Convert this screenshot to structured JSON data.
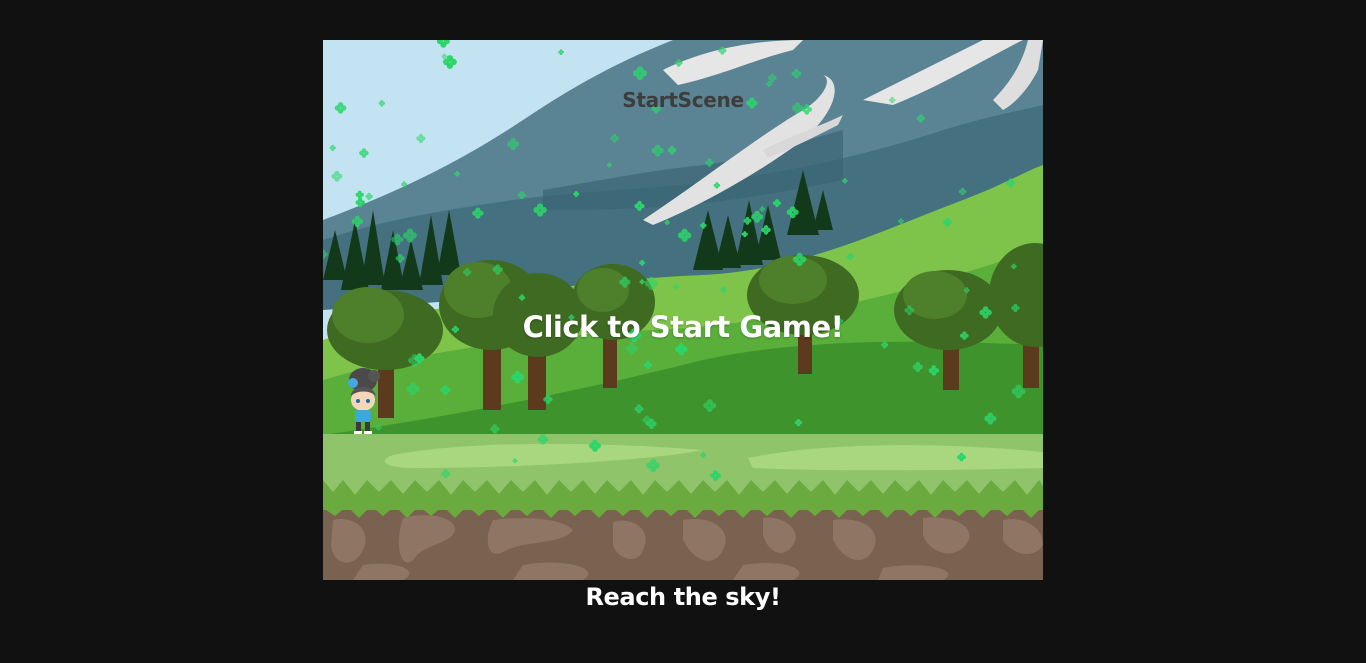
{
  "game": {
    "scene_label": "StartScene",
    "start_prompt": "Click to Start Game!",
    "caption": "Reach the sky!"
  },
  "colors": {
    "page_background": "#111111",
    "sky": "#c4e3f2",
    "mountain_far": "#5a8494",
    "mountain_near": "#44707f",
    "snow": "#e6e6e6",
    "hill_light": "#7fc44a",
    "hill_mid": "#5aae3a",
    "hill_dark": "#3f932c",
    "pine": "#123a1a",
    "tree_foliage": "#3f6a22",
    "tree_trunk": "#5b3a1e",
    "ground_grass": "#8fc46a",
    "ground_path": "#a9d77f",
    "dirt": "#7a6250",
    "dirt_light": "#8f7664",
    "clover_particles": "#2bd66a"
  },
  "sprites": [
    "player-character",
    "clover-particles"
  ]
}
